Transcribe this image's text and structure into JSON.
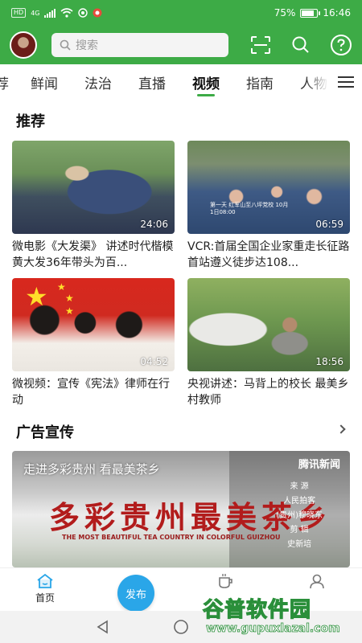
{
  "status_bar": {
    "network_badge": "HD",
    "signal_label": "4G",
    "battery_percent": "75%",
    "battery_level": 0.75,
    "time": "16:46"
  },
  "header": {
    "search_placeholder": "搜索",
    "icons": [
      "scan-icon",
      "search-icon",
      "help-icon"
    ]
  },
  "tabs": {
    "items": [
      "荐",
      "鲜闻",
      "法治",
      "直播",
      "视频",
      "指南",
      "人物"
    ],
    "active_index": 4
  },
  "recommend": {
    "title": "推荐",
    "videos": [
      {
        "title": "微电影《大发渠》 讲述时代楷模黄大发36年带头为百...",
        "duration": "24:06"
      },
      {
        "title": "VCR:首届全国企业家重走长征路 首站遵义徒步达108...",
        "duration": "06:59",
        "overlay": "第一天 红军山至八坪党校 10月1日08:00"
      },
      {
        "title": "微视频：宣传《宪法》律师在行动",
        "duration": "04:52"
      },
      {
        "title": "央视讲述：马背上的校长 最美乡村教师",
        "duration": "18:56"
      }
    ]
  },
  "ads": {
    "title": "广告宣传",
    "banner": {
      "top_text": "走进多彩贵州 看最美茶乡",
      "logo_text": "腾讯新闻",
      "calligraphy": "多彩贵州最美茶乡",
      "english": "THE MOST BEAUTIFUL TEA COUNTRY IN COLORFUL GUIZHOU",
      "credits": [
        "来 源",
        "人民拍客",
        "(贵州)穆晓东",
        "剪 辑",
        "史新培"
      ]
    }
  },
  "bottom_nav": {
    "home_label": "首页",
    "publish_label": "发布"
  },
  "watermark": {
    "cn": "谷普软件园",
    "en": "www.gupuxlazal.com"
  },
  "colors": {
    "brand_green": "#3dab46",
    "publish_blue": "#2aa6e8"
  }
}
